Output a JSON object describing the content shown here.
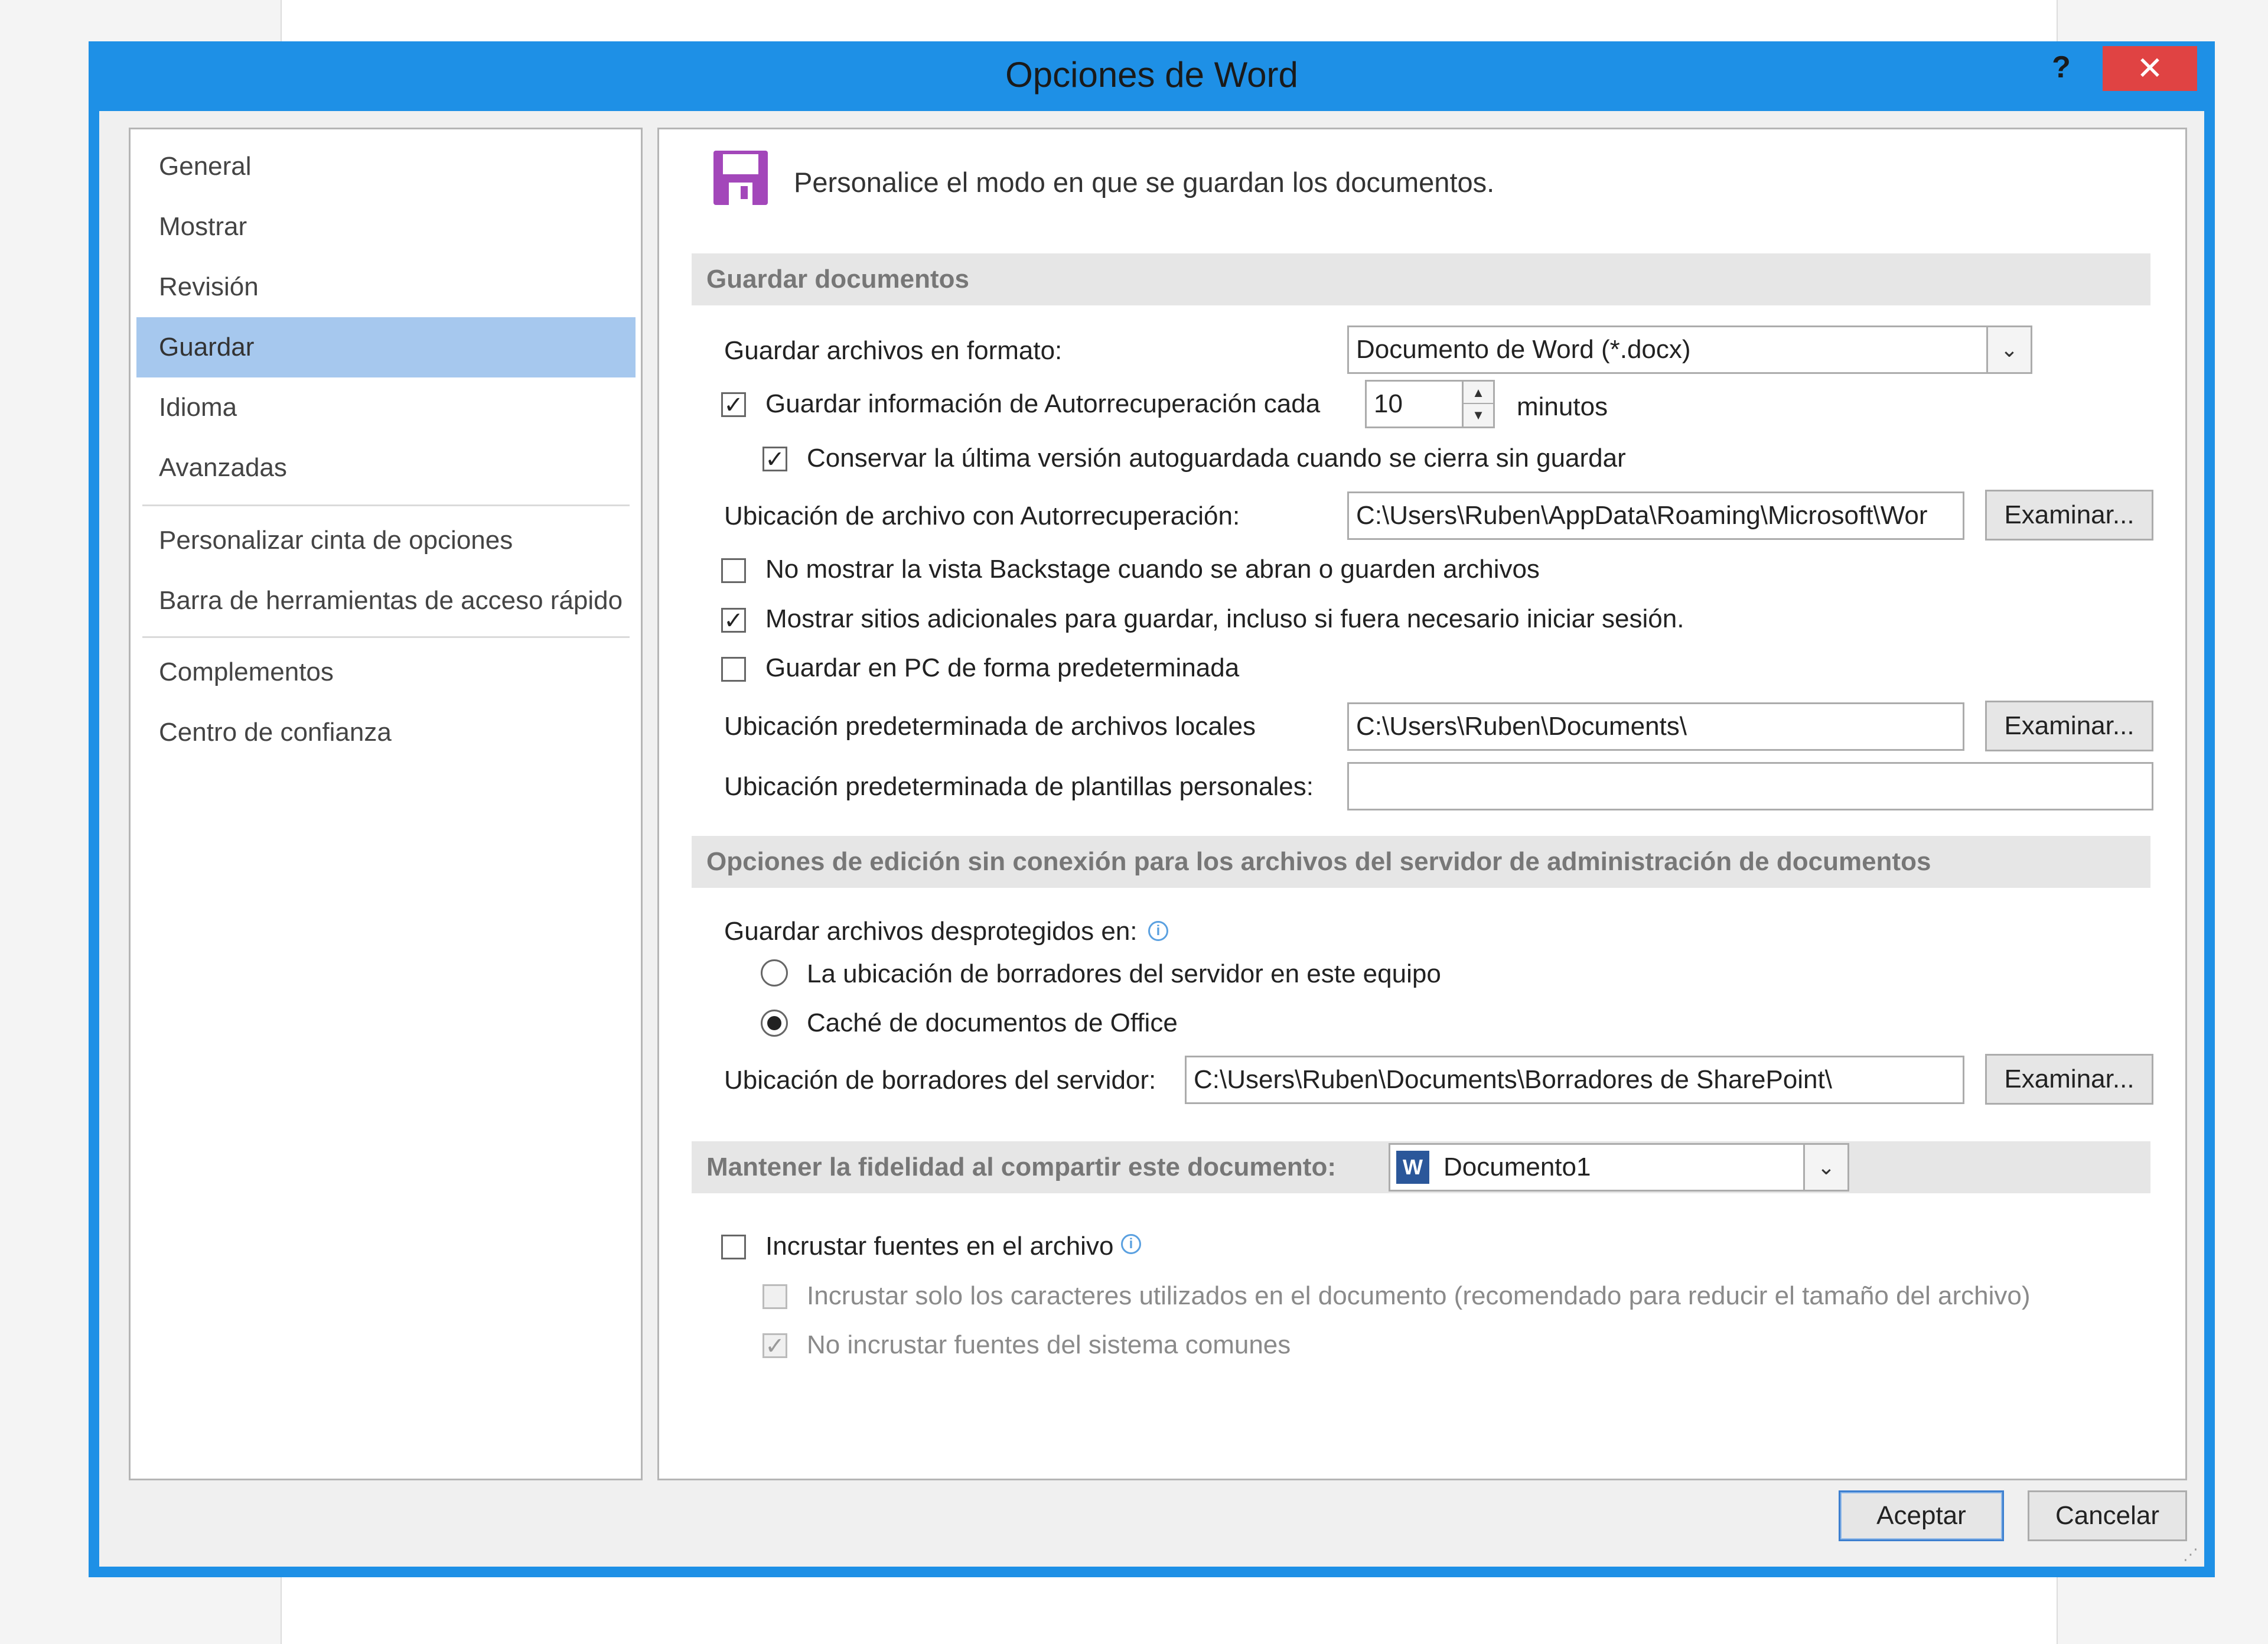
{
  "window": {
    "title": "Opciones de Word",
    "help_label": "?",
    "close_label": "✕"
  },
  "nav": {
    "items": [
      {
        "label": "General"
      },
      {
        "label": "Mostrar"
      },
      {
        "label": "Revisión"
      },
      {
        "label": "Guardar"
      },
      {
        "label": "Idioma"
      },
      {
        "label": "Avanzadas"
      },
      {
        "label": "Personalizar cinta de opciones"
      },
      {
        "label": "Barra de herramientas de acceso rápido"
      },
      {
        "label": "Complementos"
      },
      {
        "label": "Centro de confianza"
      }
    ],
    "selected": "Guardar"
  },
  "header": {
    "text": "Personalice el modo en que se guardan los documentos.",
    "icon": "floppy-disk-icon"
  },
  "save_docs": {
    "section_title": "Guardar documentos",
    "format_label": "Guardar archivos en formato:",
    "format_value": "Documento de Word (*.docx)",
    "autorecover_label": "Guardar información de Autorrecuperación cada",
    "autorecover_checked": true,
    "autorecover_minutes": "10",
    "minutes_label": "minutos",
    "keep_last_label": "Conservar la última versión autoguardada cuando se cierra sin guardar",
    "keep_last_checked": true,
    "autorecover_location_label": "Ubicación de archivo con Autorrecuperación:",
    "autorecover_location_value": "C:\\Users\\Ruben\\AppData\\Roaming\\Microsoft\\Wor",
    "browse_label": "Examinar...",
    "no_backstage_label": "No mostrar la vista Backstage cuando se abran o guarden archivos",
    "no_backstage_checked": false,
    "show_sites_label": "Mostrar sitios adicionales para guardar, incluso si fuera necesario iniciar sesión.",
    "show_sites_checked": true,
    "save_pc_label": "Guardar en PC de forma predeterminada",
    "save_pc_checked": false,
    "local_location_label": "Ubicación predeterminada de archivos locales",
    "local_location_value": "C:\\Users\\Ruben\\Documents\\",
    "templates_location_label": "Ubicación predeterminada de plantillas personales:",
    "templates_location_value": ""
  },
  "offline": {
    "section_title": "Opciones de edición sin conexión para los archivos del servidor de administración de documentos",
    "checkout_label": "Guardar archivos desprotegidos en:",
    "radio_server_label": "La ubicación de borradores del servidor en este equipo",
    "radio_cache_label": "Caché de documentos de Office",
    "selected_radio": "cache",
    "drafts_location_label": "Ubicación de borradores del servidor:",
    "drafts_location_value": "C:\\Users\\Ruben\\Documents\\Borradores de SharePoint\\"
  },
  "fidelity": {
    "section_title": "Mantener la fidelidad al compartir este documento:",
    "document_value": "Documento1",
    "embed_fonts_label": "Incrustar fuentes en el archivo",
    "embed_fonts_checked": false,
    "embed_used_label": "Incrustar solo los caracteres utilizados en el documento (recomendado para reducir el tamaño del archivo)",
    "embed_used_checked": false,
    "no_system_fonts_label": "No incrustar fuentes del sistema comunes",
    "no_system_fonts_checked": true
  },
  "footer": {
    "ok_label": "Aceptar",
    "cancel_label": "Cancelar"
  },
  "colors": {
    "accent": "#1e90e6",
    "close": "#e04343",
    "nav_selected": "#a6c8ee",
    "save_icon": "#a347ba"
  }
}
